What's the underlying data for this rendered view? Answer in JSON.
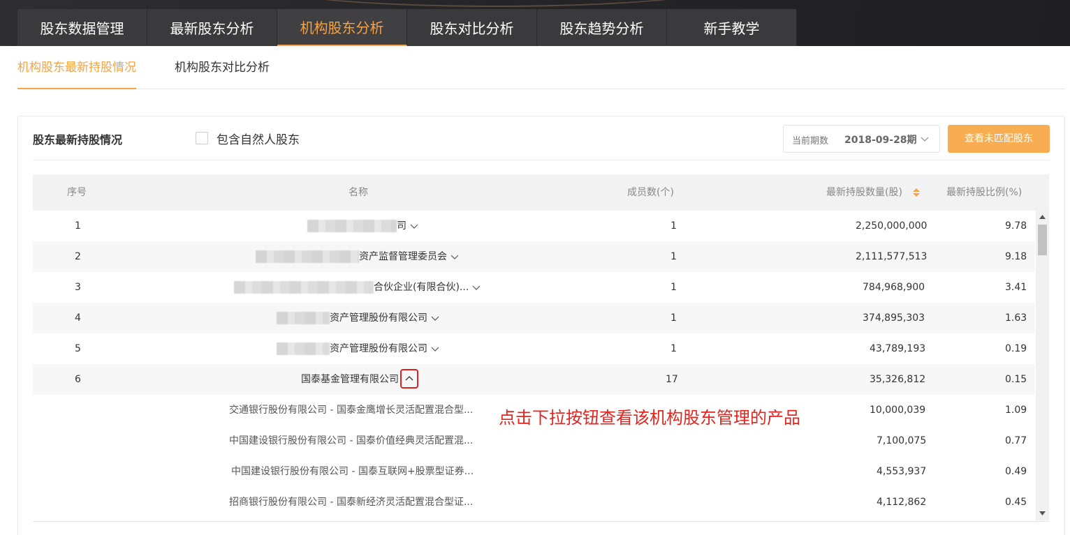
{
  "top_nav": {
    "tabs": [
      {
        "label": "股东数据管理"
      },
      {
        "label": "最新股东分析"
      },
      {
        "label": "机构股东分析",
        "active": true
      },
      {
        "label": "股东对比分析"
      },
      {
        "label": "股东趋势分析"
      },
      {
        "label": "新手教学"
      }
    ]
  },
  "sub_tabs": [
    {
      "label": "机构股东最新持股情况",
      "active": true
    },
    {
      "label": "机构股东对比分析"
    }
  ],
  "card": {
    "title": "股东最新持股情况",
    "checkbox_label": "包含自然人股东",
    "period_label": "当前期数",
    "period_value": "2018-09-28期",
    "unmatched_button": "查看未匹配股东"
  },
  "table": {
    "headers": {
      "index": "序号",
      "name": "名称",
      "members": "成员数(个)",
      "holdings": "最新持股数量(股)",
      "ratio": "最新持股比例(%)"
    },
    "rows": [
      {
        "index": "1",
        "name": "司",
        "members": "1",
        "holdings": "2,250,000,000",
        "ratio": "9.78"
      },
      {
        "index": "2",
        "name": "资产监督管理委员会",
        "members": "1",
        "holdings": "2,111,577,513",
        "ratio": "9.18"
      },
      {
        "index": "3",
        "name": "合伙企业(有限合伙)...",
        "members": "1",
        "holdings": "784,968,900",
        "ratio": "3.41"
      },
      {
        "index": "4",
        "name": "资产管理股份有限公司",
        "members": "1",
        "holdings": "374,895,303",
        "ratio": "1.63"
      },
      {
        "index": "5",
        "name": "资产管理股份有限公司",
        "members": "1",
        "holdings": "43,789,193",
        "ratio": "0.19"
      },
      {
        "index": "6",
        "name": "国泰基金管理有限公司",
        "members": "17",
        "holdings": "35,326,812",
        "ratio": "0.15"
      }
    ],
    "sub_rows": [
      {
        "name": "交通银行股份有限公司 - 国泰金鹰增长灵活配置混合型...",
        "holdings": "10,000,039",
        "ratio": "1.09"
      },
      {
        "name": "中国建设银行股份有限公司 - 国泰价值经典灵活配置混...",
        "holdings": "7,100,075",
        "ratio": "0.77"
      },
      {
        "name": "中国建设银行股份有限公司 - 国泰互联网+股票型证券...",
        "holdings": "4,553,937",
        "ratio": "0.49"
      },
      {
        "name": "招商银行股份有限公司 - 国泰新经济灵活配置混合型证...",
        "holdings": "4,112,862",
        "ratio": "0.45"
      }
    ]
  },
  "annotation": "点击下拉按钮查看该机构股东管理的产品",
  "colors": {
    "accent": "#f7a343",
    "annotation": "#e8231e",
    "button": "#f8ad53"
  }
}
